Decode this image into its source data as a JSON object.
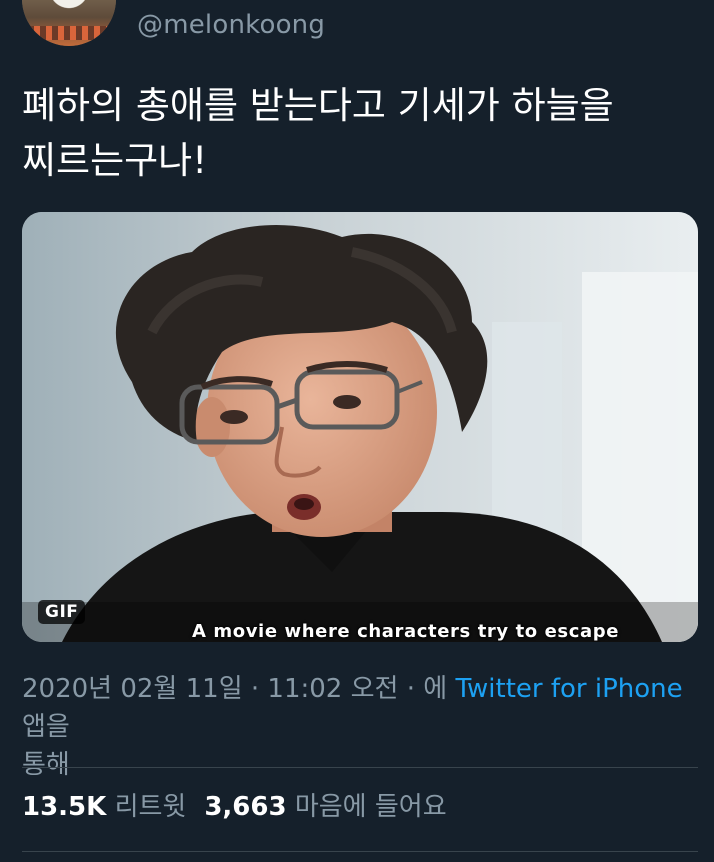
{
  "author": {
    "handle": "@melonkoong",
    "avatar_icon": "hamster-avatar"
  },
  "tweet": {
    "text_line1": "폐하의 총애를 받는다고 기세가 하늘을",
    "text_line2": "찌르는구나!"
  },
  "media": {
    "badge": "GIF",
    "caption": "A movie where characters try to escape"
  },
  "meta": {
    "timestamp": "2020년 02월 11일 · 11:02 오전 · 에",
    "source": "Twitter for iPhone",
    "suffix_line1": "앱을",
    "suffix_line2": "통해"
  },
  "stats": {
    "retweets_count": "13.5K",
    "retweets_label": "리트윗",
    "likes_count": "3,663",
    "likes_label": "마음에 들어요"
  },
  "colors": {
    "background": "#15202b",
    "link": "#1da1f2",
    "secondary_text": "#8899a6",
    "divider": "#38444d"
  }
}
